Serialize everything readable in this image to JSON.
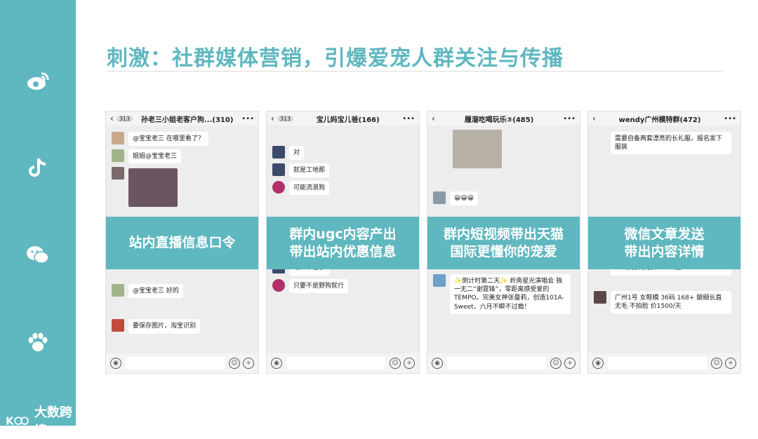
{
  "title": "刺激：社群媒体营销，引爆爱宠人群关注与传播",
  "brand": {
    "name": "大数跨境"
  },
  "sidebar": {
    "icons": [
      "weibo-icon",
      "tiktok-icon",
      "wechat-icon",
      "paw-icon"
    ]
  },
  "colors": {
    "accent": "#5fb7bf"
  },
  "panels": [
    {
      "header_badge": "313",
      "header_name": "孙老三小姐老客户狗...(310)",
      "band_line1": "站内直播信息口令",
      "band_line2": "",
      "messages": [
        "@宝宝老三 在哪里看了？",
        "姐姐@宝宝老三",
        "@宝宝老三 好的",
        "要保存图片，淘宝识别"
      ]
    },
    {
      "header_badge": "313",
      "header_name": "宝儿妈宝儿爸(166)",
      "band_line1": "群内ugc内容产出",
      "band_line2": "带出站内优惠信息",
      "messages": [
        "对",
        "就是工地那",
        "可能流浪狗",
        "嗯，不管了",
        "只要不是野狗就行"
      ]
    },
    {
      "header_badge": "",
      "header_name": "履溜吃喝玩乐③(485)",
      "band_line1": "群内短视频带出天猫",
      "band_line2": "国际更懂你的宠爱",
      "messages": [
        "😀😀😀",
        "✨倒计时第二天✨ 岭南星光演唱会 独一无二“谢霆锋”，零距离感受爱的TEMPO。完美女神张曼莉，创造101A-Sweet，六月不瞬不过瘾！"
      ]
    },
    {
      "header_badge": "",
      "header_name": "wendy广州模特群(472)",
      "band_line1": "微信文章发送",
      "band_line2": "带出内容详情",
      "messages": [
        "需要自备两套漂亮的长礼服，报名发下服装",
        "礼仪 7月12.13，2天公司慈善会网需要2个净身高礼仪168以上",
        "广州1号 女鞋模 36码 168+ 腿细长直 无毛 不拍脸 价1500/天"
      ]
    }
  ]
}
